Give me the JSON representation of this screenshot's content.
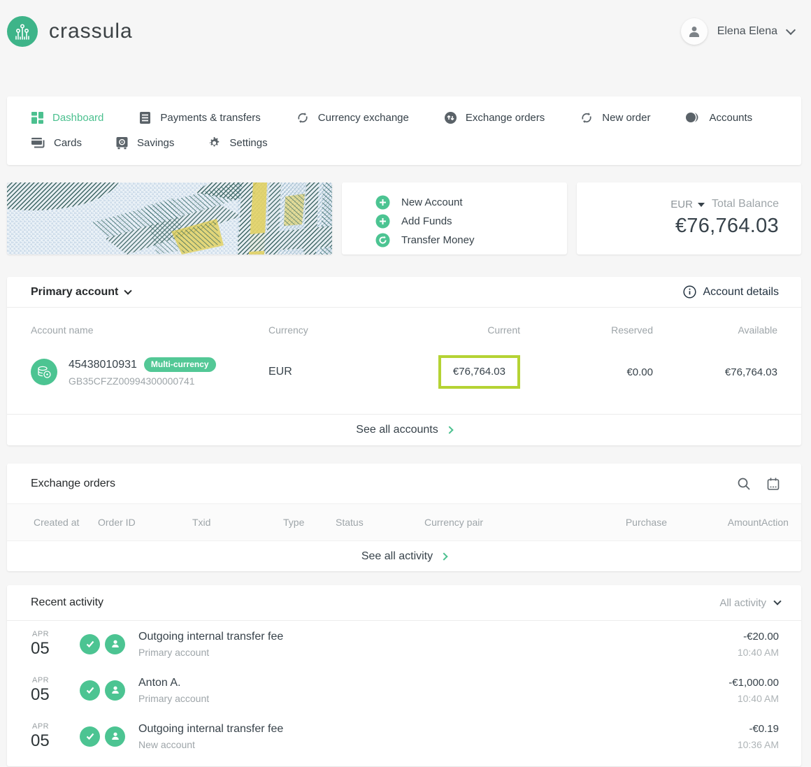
{
  "brand": {
    "name": "crassula"
  },
  "user": {
    "name": "Elena Elena"
  },
  "nav": {
    "row1": [
      {
        "label": "Dashboard",
        "icon": "dashboard-grid-icon",
        "active": true
      },
      {
        "label": "Payments & transfers",
        "icon": "payments-list-icon"
      },
      {
        "label": "Currency exchange",
        "icon": "exchange-arrows-icon"
      },
      {
        "label": "Exchange orders",
        "icon": "orders-circle-arrows-icon"
      },
      {
        "label": "New order",
        "icon": "refresh-arrows-icon"
      },
      {
        "label": "Accounts",
        "icon": "accounts-circles-icon"
      }
    ],
    "row2": [
      {
        "label": "Cards",
        "icon": "cards-icon"
      },
      {
        "label": "Savings",
        "icon": "safe-icon"
      },
      {
        "label": "Settings",
        "icon": "gear-icon"
      }
    ]
  },
  "quick_actions": {
    "items": [
      {
        "label": "New Account",
        "icon": "plus-circle-icon"
      },
      {
        "label": "Add Funds",
        "icon": "plus-circle-icon"
      },
      {
        "label": "Transfer Money",
        "icon": "transfer-circle-icon"
      }
    ]
  },
  "balance": {
    "currency": "EUR",
    "label": "Total Balance",
    "amount": "€76,764.03"
  },
  "primary_account": {
    "title": "Primary account",
    "details_label": "Account details",
    "columns": [
      "Account name",
      "Currency",
      "Current",
      "Reserved",
      "Available"
    ],
    "row": {
      "number": "45438010931",
      "badge": "Multi-currency",
      "iban": "GB35CFZZ00994300000741",
      "currency": "EUR",
      "current": "€76,764.03",
      "reserved": "€0.00",
      "available": "€76,764.03"
    },
    "footer": "See all accounts"
  },
  "exchange_orders": {
    "title": "Exchange orders",
    "columns": [
      "Created at",
      "Order ID",
      "Txid",
      "Type",
      "Status",
      "Currency pair",
      "Purchase",
      "Amount",
      "Action"
    ],
    "footer": "See all activity"
  },
  "recent_activity": {
    "title": "Recent activity",
    "filter": "All activity",
    "rows": [
      {
        "month": "APR",
        "day": "05",
        "title": "Outgoing internal transfer fee",
        "subtitle": "Primary account",
        "amount": "-€20.00",
        "time": "10:40 AM"
      },
      {
        "month": "APR",
        "day": "05",
        "title": "Anton A.",
        "subtitle": "Primary account",
        "amount": "-€1,000.00",
        "time": "10:40 AM"
      },
      {
        "month": "APR",
        "day": "05",
        "title": "Outgoing internal transfer fee",
        "subtitle": "New account",
        "amount": "-€0.19",
        "time": "10:36 AM"
      }
    ]
  },
  "colors": {
    "accent": "#4bc08f",
    "badge_green": "#53c896",
    "highlight": "#b5d334"
  }
}
